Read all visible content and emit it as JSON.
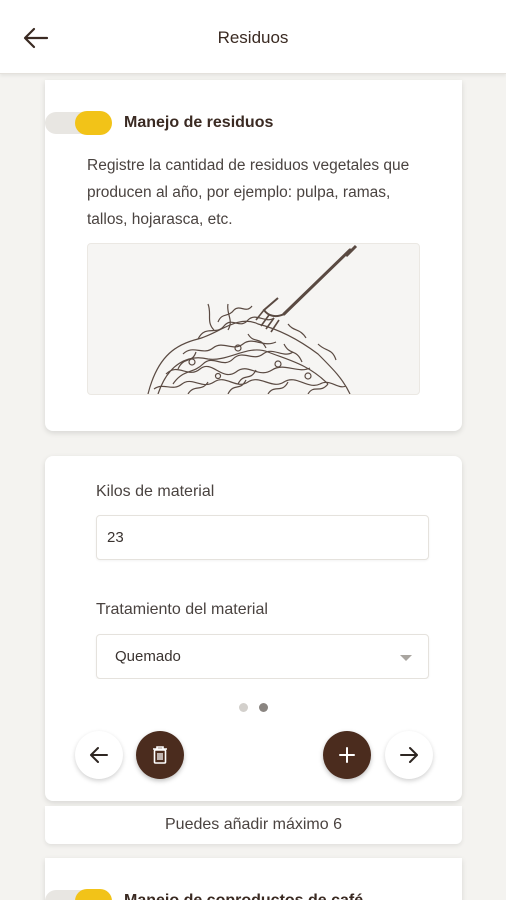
{
  "header": {
    "title": "Residuos",
    "back_icon": "arrow-left-icon"
  },
  "section1": {
    "title": "Manejo de residuos",
    "toggle_color": "#f2c318",
    "description": "Registre la cantidad de residuos vegetales que producen al año, por ejemplo: pulpa, ramas, tallos, hojarasca, etc."
  },
  "form": {
    "kilos_label": "Kilos de material",
    "kilos_value": "23",
    "treatment_label": "Tratamiento del material",
    "treatment_value": "Quemado",
    "pagination": {
      "pages": 2,
      "active": 2
    }
  },
  "actions": {
    "prev_icon": "arrow-left-icon",
    "delete_icon": "trash-icon",
    "add_icon": "plus-icon",
    "next_icon": "arrow-right-icon",
    "accent_color": "#4b2c1e"
  },
  "note": "Puedes añadir máximo 6",
  "section2": {
    "title": "Manejo de coproductos de café",
    "toggle_color": "#f2c318"
  }
}
